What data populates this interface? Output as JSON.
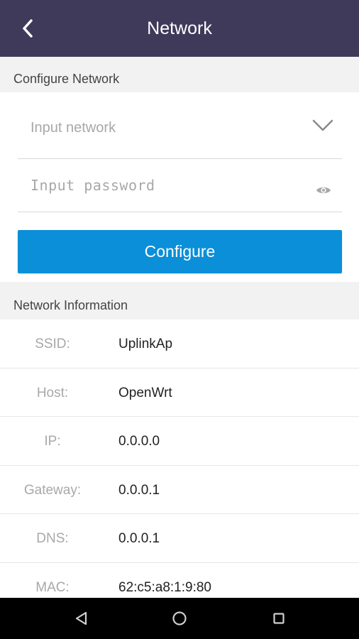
{
  "app_bar": {
    "title": "Network",
    "back_icon": "chevron-left-icon",
    "background": "#3f3a5a"
  },
  "configure_section": {
    "header": "Configure Network",
    "network_placeholder": "Input network",
    "password_placeholder": "Input password",
    "dropdown_icon": "chevron-down-icon",
    "visibility_icon": "eye-icon",
    "configure_label": "Configure",
    "accent": "#0a8fd8"
  },
  "info_section": {
    "header": "Network Information",
    "rows": [
      {
        "label": "SSID:",
        "value": "UplinkAp"
      },
      {
        "label": "Host:",
        "value": "OpenWrt"
      },
      {
        "label": "IP:",
        "value": "0.0.0.0"
      },
      {
        "label": "Gateway:",
        "value": "0.0.0.1"
      },
      {
        "label": "DNS:",
        "value": "0.0.0.1"
      },
      {
        "label": "MAC:",
        "value": "62:c5:a8:1:9:80"
      }
    ]
  },
  "nav_bar": {
    "back_icon": "triangle-back-icon",
    "home_icon": "circle-home-icon",
    "recent_icon": "square-recents-icon"
  }
}
